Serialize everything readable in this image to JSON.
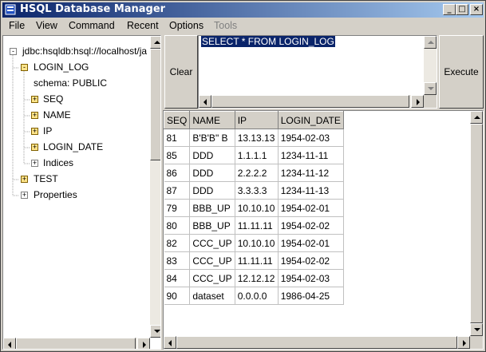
{
  "window": {
    "title": "HSQL Database Manager"
  },
  "titlebar_buttons": {
    "minimize": "_",
    "maximize": "□",
    "close": "×"
  },
  "menu": {
    "items": [
      {
        "label": "File",
        "enabled": true
      },
      {
        "label": "View",
        "enabled": true
      },
      {
        "label": "Command",
        "enabled": true
      },
      {
        "label": "Recent",
        "enabled": true
      },
      {
        "label": "Options",
        "enabled": true
      },
      {
        "label": "Tools",
        "enabled": false
      }
    ]
  },
  "tree": {
    "root": {
      "label": "jdbc:hsqldb:hsql://localhost/ja",
      "toggle": "-"
    },
    "table": {
      "label": "LOGIN_LOG",
      "toggle": "-"
    },
    "schema": {
      "label": "schema: PUBLIC"
    },
    "columns": [
      {
        "label": "SEQ",
        "toggle": "+"
      },
      {
        "label": "NAME",
        "toggle": "+"
      },
      {
        "label": "IP",
        "toggle": "+"
      },
      {
        "label": "LOGIN_DATE",
        "toggle": "+"
      }
    ],
    "indices": {
      "label": "Indices",
      "toggle": "+"
    },
    "test": {
      "label": "TEST",
      "toggle": "+"
    },
    "properties": {
      "label": "Properties",
      "toggle": "+"
    }
  },
  "query": {
    "clear_label": "Clear",
    "execute_label": "Execute",
    "sql": "SELECT * FROM LOGIN_LOG"
  },
  "results": {
    "columns": [
      "SEQ",
      "NAME",
      "IP",
      "LOGIN_DATE"
    ],
    "rows": [
      [
        "81",
        "B'B'B\" B",
        "13.13.13",
        "1954-02-03"
      ],
      [
        "85",
        "DDD",
        "1.1.1.1",
        "1234-11-11"
      ],
      [
        "86",
        "DDD",
        "2.2.2.2",
        "1234-11-12"
      ],
      [
        "87",
        "DDD",
        "3.3.3.3",
        "1234-11-13"
      ],
      [
        "79",
        "BBB_UP",
        "10.10.10",
        "1954-02-01"
      ],
      [
        "80",
        "BBB_UP",
        "11.11.11",
        "1954-02-02"
      ],
      [
        "82",
        "CCC_UP",
        "10.10.10",
        "1954-02-01"
      ],
      [
        "83",
        "CCC_UP",
        "11.11.11",
        "1954-02-02"
      ],
      [
        "84",
        "CCC_UP",
        "12.12.12",
        "1954-02-03"
      ],
      [
        "90",
        "dataset",
        "0.0.0.0",
        "1986-04-25"
      ]
    ]
  },
  "colors": {
    "title_start": "#0a246a",
    "title_end": "#a6caf0",
    "chrome": "#d4d0c8",
    "selection": "#0a246a",
    "tree_toggle_open": "#ffe48a"
  }
}
